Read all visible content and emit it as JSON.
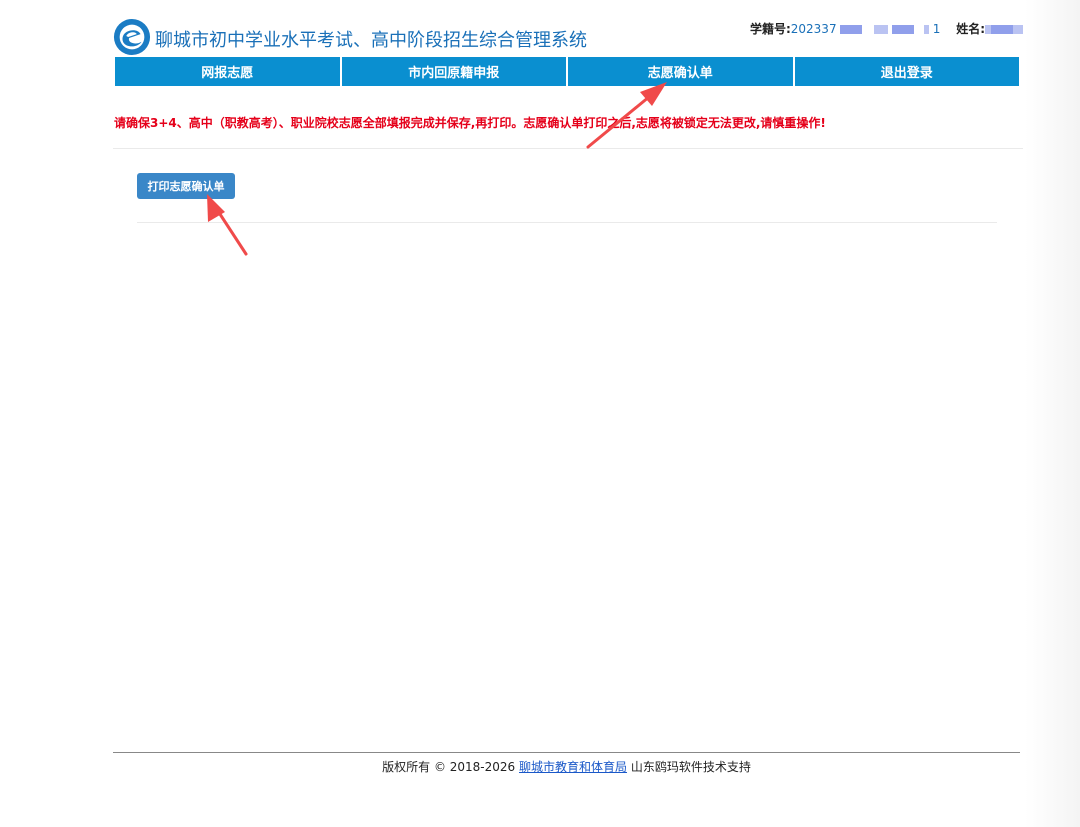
{
  "header": {
    "title": "聊城市初中学业水平考试、高中阶段招生综合管理系统",
    "student_id_label": "学籍号:",
    "student_id_value": "202337",
    "student_id_suffix": "1",
    "name_label": "姓名:"
  },
  "nav": {
    "items": [
      {
        "label": "网报志愿"
      },
      {
        "label": "市内回原籍申报"
      },
      {
        "label": "志愿确认单"
      },
      {
        "label": "退出登录"
      }
    ]
  },
  "main": {
    "warning": "请确保3+4、高中（职教高考）、职业院校志愿全部填报完成并保存,再打印。志愿确认单打印之后,志愿将被锁定无法更改,请慎重操作!",
    "print_button_label": "打印志愿确认单"
  },
  "footer": {
    "copyright": "版权所有 © 2018-2026",
    "link_text": "聊城市教育和体育局",
    "support": "山东鸥玛软件技术支持"
  },
  "colors": {
    "brand_blue": "#1a70b8",
    "nav_blue": "#0a8fd0",
    "warning_red": "#e5001a",
    "button_blue": "#3a87c8",
    "annotation_arrow": "#f04a4a"
  }
}
